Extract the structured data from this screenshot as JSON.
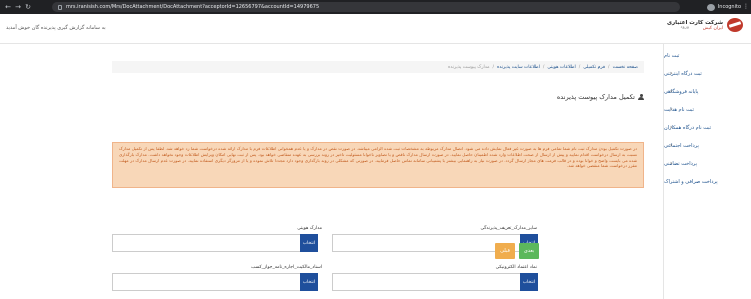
{
  "browser": {
    "url": "mrs.iranisish.com/Mrs/DocAttachment/DocAttachment?acceptorId=12656797&accountId=14979675",
    "mode_label": "Incognito"
  },
  "header": {
    "company_name": "شرکت کارت اعتباری",
    "company_sub": "ایران کیش",
    "login_link": "ورود",
    "welcome": "به سامانه گزارش گیری پذیرنده گان خوش آمدید"
  },
  "sidebar": {
    "items": [
      {
        "label": "ثبت نام",
        "chevron": false
      },
      {
        "label": "ثبت درگاه اینترنتی",
        "chevron": true
      },
      {
        "label": "پایانه فروشگاهی",
        "chevron": true
      },
      {
        "label": "ثبت نام هدایت",
        "chevron": true
      },
      {
        "label": "ثبت نام درگاه همکاران",
        "chevron": true
      },
      {
        "label": "پرداخت اجتماعی",
        "chevron": true
      },
      {
        "label": "پرداخت تضامنی",
        "chevron": true
      },
      {
        "label": "پرداخت صرافی و اشتراک",
        "chevron": false
      }
    ]
  },
  "breadcrumb": {
    "items": [
      "صفحه نخست",
      "فرم تکمیلی",
      "اطلاعات هویتی",
      "اطلاعات سایت پذیرنده"
    ],
    "current": "مدارک پیوست پذیرنده"
  },
  "page": {
    "title": "تکمیل مدارک پیوست پذیرنده"
  },
  "warning": {
    "text": "در صورت تکمیل بودن مدارک ثبت نام شما تمامی فرم ها به صورت غیر فعال نمایش داده می شود. اتصال مدارک مربوطه به مشخصات ثبت شده الزامی میباشد. در صورت نقص در مدارک و یا عدم همخوانی اطلاعات فرم با مدارک ارائه شده درخواست شما رد خواهد شد. لطفا پس از تکمیل مدارک نسبت به ارسال درخواست اقدام نمایید و پیش از ارسال از صحت اطلاعات وارد شده اطمینان حاصل نمایید. در صورت ارسال مدارک ناقص و یا تصاویر ناخوانا مسئولیت تاخیر در روند بررسی به عهده متقاضی خواهد بود. پس از ثبت نهایی امکان ویرایش اطلاعات وجود نخواهد داشت. مدارک بارگذاری شده می بایست واضح و خوانا بوده و در قالب فرمت های مجاز ارسال گردد. در صورت نیاز به راهنمایی بیشتر با پشتیبانی سامانه تماس حاصل فرمایید. در صورتی که مشکلی در روند بارگذاری وجود دارد مجددا تلاش نموده و یا از مرورگر دیگری استفاده نمایید. در صورت عدم ارسال مدارک در مهلت مقرر درخواست شما منقضی خواهد شد."
  },
  "fields": [
    {
      "label": "مدارک هویتی",
      "button": "انتخاب"
    },
    {
      "label": "سایر_مدارک_تعریف_پذیرندگی",
      "button": "انتخاب"
    },
    {
      "label": "اسناد_مالکیت_اجاره_نامه_جواز_کسب",
      "button": "انتخاب"
    },
    {
      "label": "نماد اعتماد الکترونیکی",
      "button": "انتخاب"
    }
  ],
  "actions": {
    "next": "بعدی",
    "prev": "قبلی"
  },
  "colors": {
    "primary": "#1f4f9c",
    "next": "#5cb85c",
    "prev": "#f0ad4e",
    "warning_bg": "#f8d7b8",
    "warning_text": "#c25b1e"
  }
}
